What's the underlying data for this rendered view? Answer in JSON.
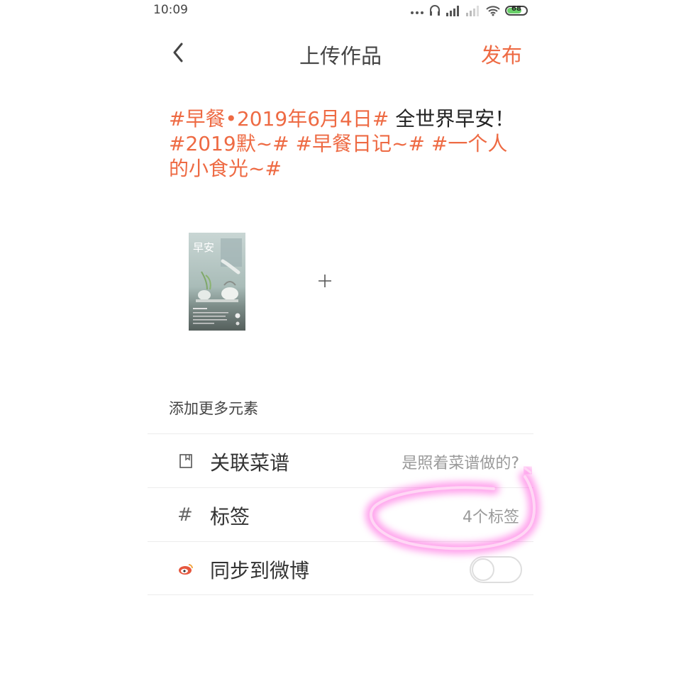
{
  "status_bar": {
    "time": "10:09",
    "battery": "68",
    "icons": [
      "more-dots-icon",
      "headset-icon",
      "signal-icon",
      "signal-weak-icon",
      "wifi-icon",
      "battery-icon"
    ]
  },
  "nav": {
    "back_icon": "chevron-left-icon",
    "title": "上传作品",
    "publish_label": "发布"
  },
  "caption": {
    "tag1": "#早餐•2019年6月4日#",
    "text1": " 全世界早安！",
    "tag2": "#2019默~#",
    "tag3": "#早餐日记~#",
    "tag4": "#一个人的小食光~#"
  },
  "media": {
    "thumb_title": "早安",
    "add_icon": "plus-icon"
  },
  "more": {
    "label": "添加更多元素",
    "rows": [
      {
        "icon": "book-icon",
        "label": "关联菜谱",
        "value": "是照着菜谱做的?"
      },
      {
        "icon": "hash-icon",
        "label": "标签",
        "value": "4个标签",
        "glyph": "#"
      },
      {
        "icon": "weibo-icon",
        "label": "同步到微博",
        "toggle_on": false
      }
    ]
  },
  "colors": {
    "accent": "#ee6a43",
    "scribble": "#ff55dd"
  }
}
